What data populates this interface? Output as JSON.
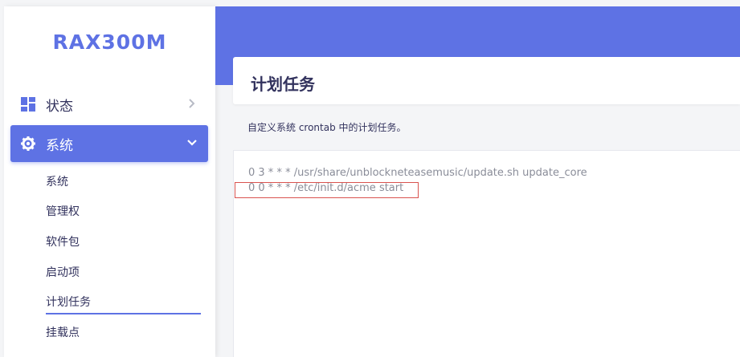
{
  "brand": {
    "name": "RAX300M",
    "color": "#5e72e4"
  },
  "sidebar": {
    "items": [
      {
        "label": "状态",
        "icon": "dashboard-icon",
        "expanded": false
      },
      {
        "label": "系统",
        "icon": "gear-icon",
        "expanded": true,
        "active": true
      }
    ],
    "subitems": [
      {
        "label": "系统"
      },
      {
        "label": "管理权"
      },
      {
        "label": "软件包"
      },
      {
        "label": "启动项"
      },
      {
        "label": "计划任务",
        "active": true
      },
      {
        "label": "挂载点"
      }
    ]
  },
  "page": {
    "title": "计划任务",
    "description": "自定义系统 crontab 中的计划任务。"
  },
  "crontab": {
    "lines": [
      "0 3 * * * /usr/share/unblockneteasemusic/update.sh update_core",
      "0 0 * * * /etc/init.d/acme start"
    ],
    "highlighted_line_index": 1,
    "highlight_color": "#d9534f"
  },
  "colors": {
    "accent": "#5e72e4",
    "text": "#32325d",
    "muted": "#8a8d99"
  }
}
